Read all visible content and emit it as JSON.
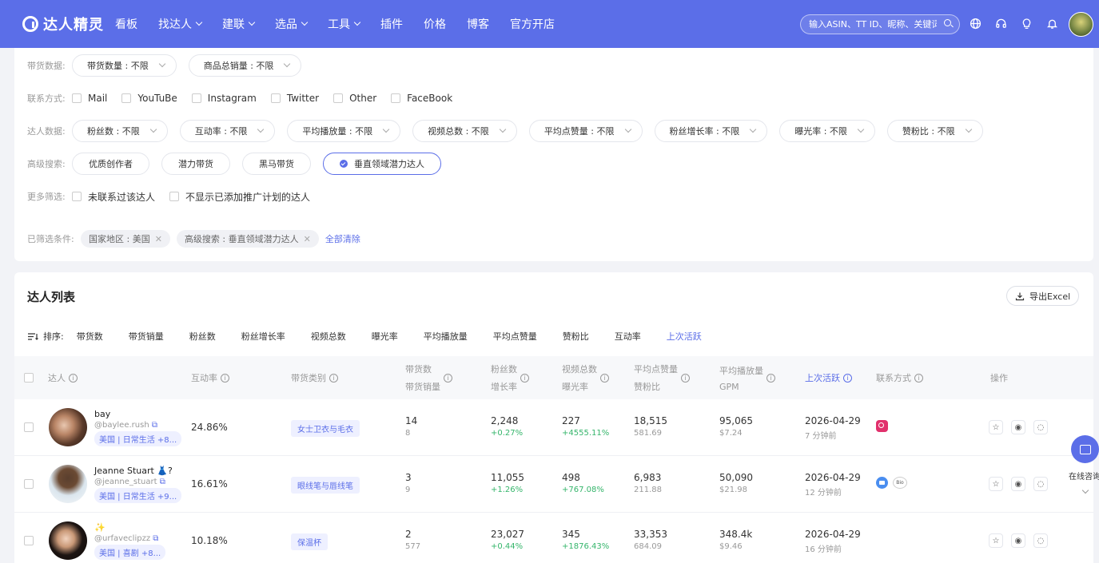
{
  "brand": "达人精灵",
  "nav": [
    "看板",
    "找达人",
    "建联",
    "选品",
    "工具",
    "插件",
    "价格",
    "博客",
    "官方开店"
  ],
  "nav_has_dropdown": [
    false,
    true,
    true,
    true,
    true,
    false,
    false,
    false,
    false
  ],
  "search_placeholder": "输入ASIN、TT ID、昵称、关键词",
  "filters": {
    "sales_label": "带货数据:",
    "sales": [
      "带货数量 : 不限",
      "商品总销量 : 不限"
    ],
    "contact_label": "联系方式:",
    "contact": [
      "Mail",
      "YouTuBe",
      "Instagram",
      "Twitter",
      "Other",
      "FaceBook"
    ],
    "creator_label": "达人数据:",
    "creator": [
      "粉丝数 : 不限",
      "互动率 : 不限",
      "平均播放量 : 不限",
      "视频总数 : 不限",
      "平均点赞量 : 不限",
      "粉丝增长率 : 不限",
      "曝光率 : 不限",
      "赞粉比 : 不限"
    ],
    "advanced_label": "高级搜索:",
    "advanced": [
      "优质创作者",
      "潜力带货",
      "黑马带货",
      "垂直领域潜力达人"
    ],
    "more_label": "更多筛选:",
    "more": [
      "未联系过该达人",
      "不显示已添加推广计划的达人"
    ],
    "selected_label": "已筛选条件:",
    "selected": [
      "国家地区 : 美国",
      "高级搜索 : 垂直领域潜力达人"
    ],
    "clear_all": "全部清除"
  },
  "list": {
    "title": "达人列表",
    "export": "导出Excel",
    "sort_label": "排序:",
    "sort": [
      "带货数",
      "带货销量",
      "粉丝数",
      "粉丝增长率",
      "视频总数",
      "曝光率",
      "平均播放量",
      "平均点赞量",
      "赞粉比",
      "互动率",
      "上次活跃"
    ],
    "headers": {
      "creator": "达人",
      "engagement": "互动率",
      "category": "带货类别",
      "sales_a": "带货数",
      "sales_b": "带货销量",
      "fans_a": "粉丝数",
      "fans_b": "增长率",
      "videos_a": "视频总数",
      "videos_b": "曝光率",
      "likes_a": "平均点赞量",
      "likes_b": "赞粉比",
      "plays_a": "平均播放量",
      "plays_b": "GPM",
      "active": "上次活跃",
      "contact": "联系方式",
      "ops": "操作"
    },
    "rows": [
      {
        "name": "bay",
        "handle": "@baylee.rush",
        "loc": "美国 | 日常生活 +8...",
        "engagement": "24.86%",
        "category": "女士卫衣与毛衣",
        "sales": "14",
        "sales_sub": "8",
        "fans": "2,248",
        "fans_growth": "+0.27%",
        "videos": "227",
        "exposure": "+4555.11%",
        "likes": "18,515",
        "like_ratio": "581.69",
        "plays": "95,065",
        "gpm": "$7.24",
        "active": "2026-04-29",
        "active_ago": "7 分钟前",
        "contact": [
          "instagram"
        ]
      },
      {
        "name": "Jeanne Stuart 👗?",
        "handle": "@jeanne_stuart",
        "loc": "美国 | 日常生活 +9...",
        "engagement": "16.61%",
        "category": "眼线笔与唇线笔",
        "sales": "3",
        "sales_sub": "9",
        "fans": "11,055",
        "fans_growth": "+1.26%",
        "videos": "498",
        "exposure": "+767.08%",
        "likes": "6,983",
        "like_ratio": "211.88",
        "plays": "50,090",
        "gpm": "$21.98",
        "active": "2026-04-29",
        "active_ago": "12 分钟前",
        "contact": [
          "mail",
          "bio"
        ]
      },
      {
        "name": "✨",
        "handle": "@urfaveclipzz",
        "loc": "美国 | 喜剧 +8...",
        "engagement": "10.18%",
        "category": "保温杯",
        "sales": "2",
        "sales_sub": "577",
        "fans": "23,027",
        "fans_growth": "+0.44%",
        "videos": "345",
        "exposure": "+1876.43%",
        "likes": "33,353",
        "like_ratio": "684.09",
        "plays": "348.4k",
        "gpm": "$9.46",
        "active": "2026-04-29",
        "active_ago": "16 分钟前",
        "contact": []
      }
    ]
  },
  "bio_label": "Bio",
  "chat_label": "在线咨询",
  "colors": {
    "brand": "#5b6ee8",
    "positive": "#35b56b"
  }
}
